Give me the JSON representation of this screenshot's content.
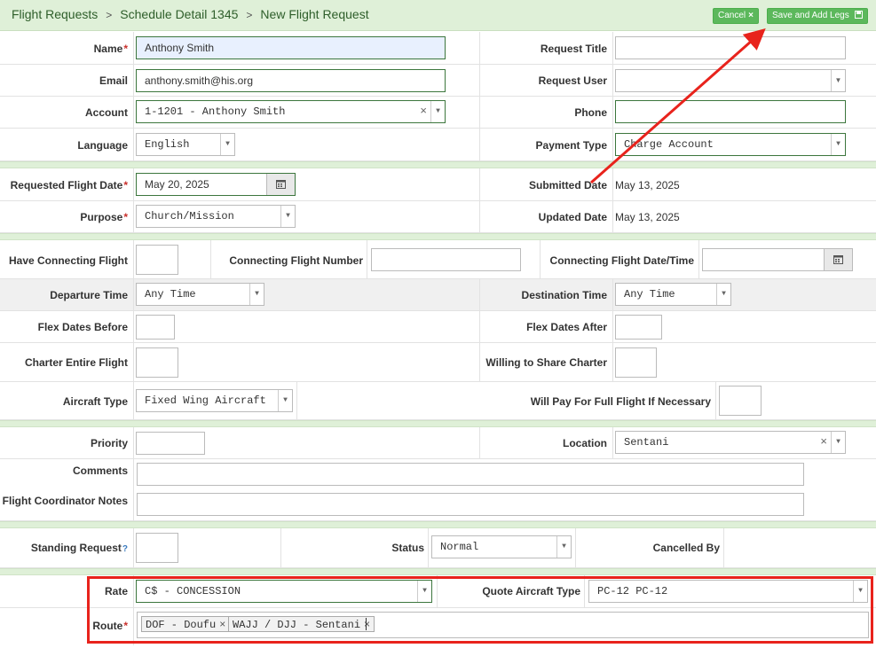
{
  "breadcrumb": [
    "Flight Requests",
    "Schedule Detail 1345",
    "New Flight Request"
  ],
  "breadcrumb_separator": ">",
  "buttons": {
    "cancel": "Cancel",
    "save": "Save and Add Legs"
  },
  "required_marker": "*",
  "section1": {
    "name_label": "Name",
    "name_value": "Anthony Smith",
    "email_label": "Email",
    "email_value": "anthony.smith@his.org",
    "account_label": "Account",
    "account_value": "1-1201 - Anthony Smith",
    "language_label": "Language",
    "language_value": "English",
    "request_title_label": "Request Title",
    "request_title_value": "",
    "request_user_label": "Request User",
    "request_user_value": "",
    "phone_label": "Phone",
    "phone_value": "",
    "payment_type_label": "Payment Type",
    "payment_type_value": "Charge Account"
  },
  "section2": {
    "requested_date_label": "Requested Flight Date",
    "requested_date_value": "May 20, 2025",
    "purpose_label": "Purpose",
    "purpose_value": "Church/Mission",
    "submitted_label": "Submitted Date",
    "submitted_value": "May 13, 2025",
    "updated_label": "Updated Date",
    "updated_value": "May 13, 2025"
  },
  "section3": {
    "have_connecting_label": "Have Connecting Flight",
    "connecting_number_label": "Connecting Flight Number",
    "connecting_datetime_label": "Connecting Flight Date/Time",
    "departure_time_label": "Departure Time",
    "departure_time_value": "Any Time",
    "destination_time_label": "Destination Time",
    "destination_time_value": "Any Time",
    "flex_before_label": "Flex Dates Before",
    "flex_after_label": "Flex Dates After",
    "charter_label": "Charter Entire Flight",
    "share_label": "Willing to Share Charter",
    "aircraft_type_label": "Aircraft Type",
    "aircraft_type_value": "Fixed Wing Aircraft",
    "full_flight_label": "Will Pay For Full Flight If Necessary"
  },
  "section4": {
    "priority_label": "Priority",
    "location_label": "Location",
    "location_value": "Sentani",
    "comments_label": "Comments",
    "coordinator_label": "Flight Coordinator Notes"
  },
  "section5": {
    "standing_label": "Standing Request",
    "help_glyph": "?",
    "status_label": "Status",
    "status_value": "Normal",
    "cancelled_label": "Cancelled By"
  },
  "section6": {
    "rate_label": "Rate",
    "rate_value": "C$ - CONCESSION",
    "quote_label": "Quote Aircraft Type",
    "quote_value": "PC-12 PC-12",
    "route_label": "Route",
    "route_tags": [
      "DOF - Doufu",
      "WAJJ / DJJ - Sentani"
    ]
  },
  "icons": {
    "clear": "×",
    "caret": "▼",
    "calendar": "calendar-icon",
    "save": "floppy-disk-icon"
  },
  "annotation_color": "#e8231c"
}
